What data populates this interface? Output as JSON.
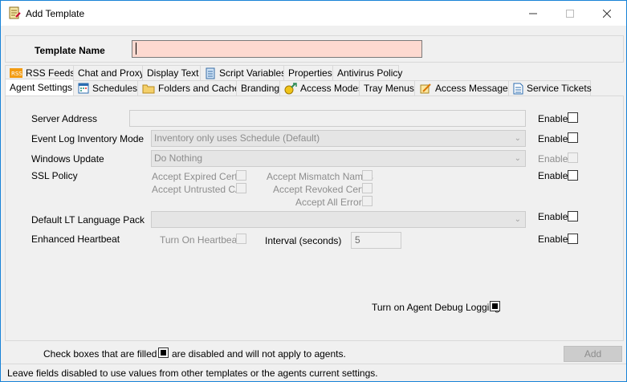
{
  "window": {
    "title": "Add Template",
    "minimize": "—",
    "maximize": "☐",
    "close": "✕"
  },
  "template_name": {
    "label": "Template Name",
    "value": ""
  },
  "tabs_row1": [
    {
      "label": "RSS Feeds",
      "icon": "rss-icon"
    },
    {
      "label": "Chat and Proxy",
      "icon": ""
    },
    {
      "label": "Display Text",
      "icon": ""
    },
    {
      "label": "Script Variables",
      "icon": "script-icon"
    },
    {
      "label": "Properties",
      "icon": ""
    },
    {
      "label": "Antivirus Policy",
      "icon": ""
    }
  ],
  "tabs_row2": [
    {
      "label": "Agent Settings",
      "icon": "",
      "active": true
    },
    {
      "label": "Schedules",
      "icon": "calendar-icon"
    },
    {
      "label": "Folders and Cache",
      "icon": "folder-icon"
    },
    {
      "label": "Branding",
      "icon": ""
    },
    {
      "label": "Access Modes",
      "icon": "access-icon"
    },
    {
      "label": "Tray Menus",
      "icon": ""
    },
    {
      "label": "Access Messages",
      "icon": "message-icon"
    },
    {
      "label": "Service Tickets",
      "icon": "ticket-icon"
    }
  ],
  "form": {
    "server_address": {
      "label": "Server Address",
      "value": ""
    },
    "event_log": {
      "label": "Event Log Inventory Mode",
      "value": "Inventory only uses Schedule (Default)"
    },
    "windows_update": {
      "label": "Windows Update",
      "value": "Do Nothing"
    },
    "ssl_policy": {
      "label": "SSL Policy",
      "accept_expired": "Accept Expired Certs",
      "accept_untrusted": "Accept Untrusted CA",
      "accept_mismatch": "Accept Mismatch Names",
      "accept_revoked": "Accept Revoked Certs",
      "accept_all": "Accept All Errors"
    },
    "language_pack": {
      "label": "Default LT Language Pack",
      "value": ""
    },
    "heartbeat": {
      "label": "Enhanced Heartbeat",
      "turn_on": "Turn On Heartbeat",
      "interval_label": "Interval (seconds)",
      "interval_value": "5"
    },
    "enable_label": "Enable",
    "debug_logging": "Turn on Agent Debug Logging"
  },
  "footer": {
    "note_part1": "Check boxes that are filled in",
    "note_part2": "are disabled and will not apply to agents.",
    "add_button": "Add",
    "status": "Leave fields disabled to use values from other templates or the agents current settings."
  }
}
